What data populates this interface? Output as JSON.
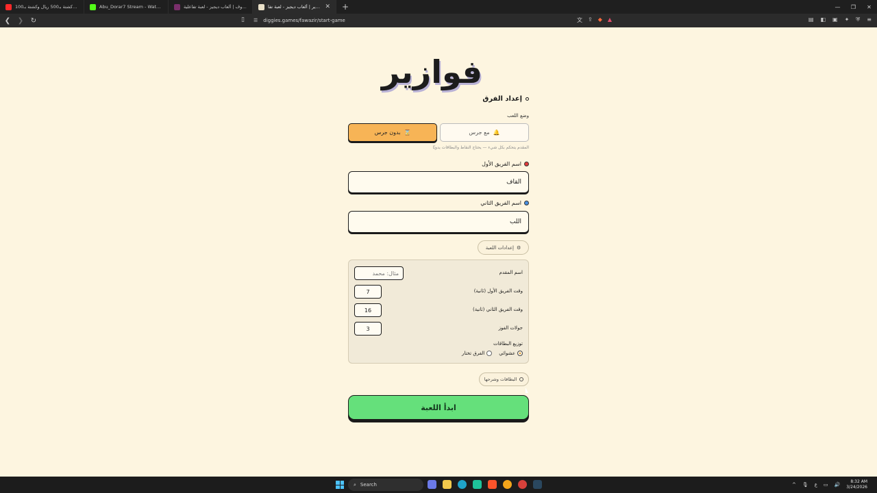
{
  "browser": {
    "tabs": [
      {
        "title": "فالكونز في كشتة بـ500 ريال وكشتة بـ100",
        "favicon_color": "#ff2a2a",
        "active": false
      },
      {
        "title": "Abu_Dorar7 Stream - Watch Live on Kick",
        "favicon_color": "#53fc18",
        "active": false
      },
      {
        "title": "لعبة حروف | ألعاب ديجيز - لعبة تفاعلية",
        "favicon_color": "#7a2f6b",
        "active": false
      },
      {
        "title": "لعبة فوازير | ألعاب ديجيز - لعبة تفا",
        "favicon_color": "#e9e0c8",
        "active": true
      }
    ],
    "new_tab_icon": "plus-icon",
    "url": "diggies.games/fawazir/start-game"
  },
  "page": {
    "logo_text": "فوازير",
    "section_title": "إعداد الفرق",
    "mode_label": "وضع اللعب",
    "mode_no_bell": "بدون جرس",
    "mode_with_bell": "مع جرس",
    "mode_helper": "المقدم يتحكم بكل شيء — يحتاج النقاط والبطاقات يدويًا",
    "team1_label": "اسم الفريق الأول",
    "team1_value": "القاف",
    "team1_color": "#e23b3b",
    "team2_label": "اسم الفريق الثاني",
    "team2_value": "اللب",
    "team2_color": "#4a90e2",
    "settings_toggle": "إعدادات اللعبة",
    "settings": {
      "host_label": "اسم المقدم",
      "host_placeholder": "مثال: محمد",
      "first_team_time_label": "وقت الفريق الأول (ثانية)",
      "first_team_time": "7",
      "second_team_time_label": "وقت الفريق الثاني (ثانية)",
      "second_team_time": "16",
      "rounds_label": "جولات الفوز",
      "rounds": "3",
      "distribution_label": "توزيع البطاقات",
      "option_random": "عشوائي",
      "option_teams_choose": "الفرق تختار",
      "selected": "random"
    },
    "cards_toggle": "البطاقات وشرحها",
    "start_button": "ابدأ اللعبة"
  },
  "taskbar": {
    "search_placeholder": "Search",
    "time": "8:32 AM",
    "date": "3/24/2026"
  }
}
